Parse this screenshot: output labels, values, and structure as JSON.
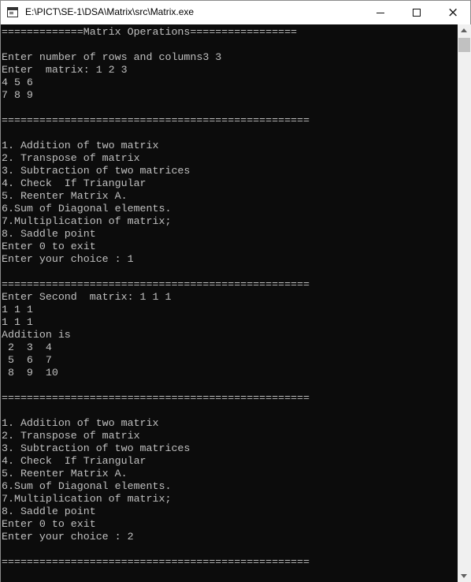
{
  "window": {
    "title": "E:\\PICT\\SE-1\\DSA\\Matrix\\src\\Matrix.exe",
    "controls": {
      "minimize": "minimize",
      "maximize": "maximize",
      "close": "×"
    }
  },
  "console": {
    "lines": [
      "=============Matrix Operations=================",
      "",
      "Enter number of rows and columns3 3",
      "Enter  matrix: 1 2 3",
      "4 5 6",
      "7 8 9",
      "",
      "=================================================",
      "",
      "1. Addition of two matrix",
      "2. Transpose of matrix",
      "3. Subtraction of two matrices",
      "4. Check  If Triangular",
      "5. Reenter Matrix A.",
      "6.Sum of Diagonal elements.",
      "7.Multiplication of matrix;",
      "8. Saddle point",
      "Enter 0 to exit",
      "Enter your choice : 1",
      "",
      "=================================================",
      "Enter Second  matrix: 1 1 1",
      "1 1 1",
      "1 1 1",
      "Addition is",
      " 2  3  4",
      " 5  6  7",
      " 8  9  10",
      "",
      "=================================================",
      "",
      "1. Addition of two matrix",
      "2. Transpose of matrix",
      "3. Subtraction of two matrices",
      "4. Check  If Triangular",
      "5. Reenter Matrix A.",
      "6.Sum of Diagonal elements.",
      "7.Multiplication of matrix;",
      "8. Saddle point",
      "Enter 0 to exit",
      "Enter your choice : 2",
      "",
      "================================================="
    ]
  },
  "colors": {
    "console_bg": "#0c0c0c",
    "console_text": "#c0c0c0",
    "titlebar_bg": "#ffffff",
    "scrollbar_bg": "#f0f0f0"
  }
}
